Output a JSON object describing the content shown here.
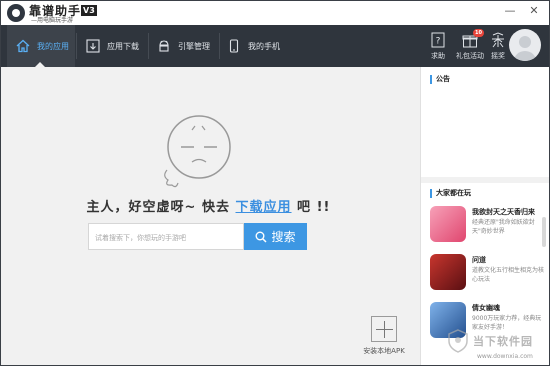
{
  "app": {
    "name": "靠谱助手",
    "version": "V3",
    "slogan": "—用电脑玩手游"
  },
  "window_controls": {
    "minimize": "—",
    "close": "✕"
  },
  "nav": {
    "tabs": [
      {
        "label": "我的应用",
        "icon": "home-icon",
        "active": true
      },
      {
        "label": "应用下载",
        "icon": "download-icon",
        "active": false
      },
      {
        "label": "引擎管理",
        "icon": "android-icon",
        "active": false
      },
      {
        "label": "我的手机",
        "icon": "phone-icon",
        "active": false
      }
    ],
    "right": [
      {
        "label": "求助",
        "icon": "help-icon"
      },
      {
        "label": "礼包活动",
        "icon": "gift-icon",
        "badge": "10"
      },
      {
        "label": "摇奖",
        "icon": "lottery-icon"
      }
    ]
  },
  "main": {
    "empty_prefix": "主人，好空虚呀~ 快去",
    "empty_link": "下载应用",
    "empty_suffix": "吧 !!",
    "search_placeholder": "试着搜索下，你想玩的手游吧",
    "search_button": "搜索",
    "install_apk": "安装本地APK"
  },
  "sidebar": {
    "notice_title": "公告",
    "popular_title": "大家都在玩",
    "games": [
      {
        "name": "我欲封天之天香归来",
        "desc": "经典还原\"我命如妖欲封天\"奇妙世界",
        "color": "#e86a8a"
      },
      {
        "name": "问道",
        "desc": "道教文化五行相生相克为核心玩法",
        "color": "#a8252a"
      },
      {
        "name": "倩女幽魂",
        "desc": "9000万玩家力荐，经典玩家友好手游！",
        "color": "#3a6fb8"
      }
    ]
  },
  "watermark": {
    "text": "当下软件园",
    "url": "www.downxia.com"
  }
}
